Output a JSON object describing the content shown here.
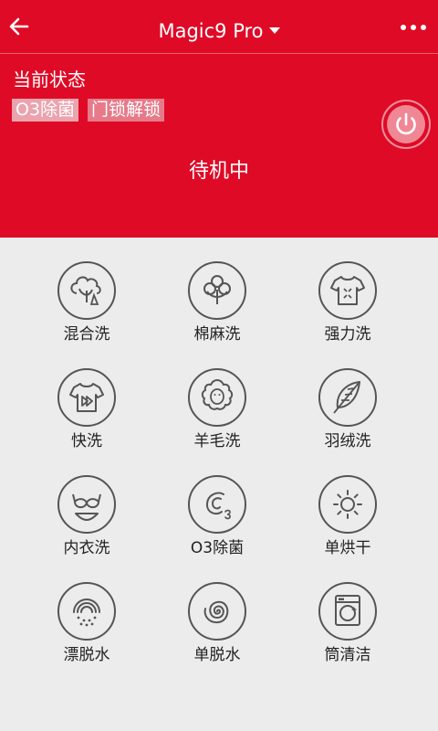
{
  "topbar": {
    "title": "Magic9 Pro",
    "back_icon": "arrow-left-icon",
    "more_icon": "more-dots-icon"
  },
  "status": {
    "label": "当前状态",
    "chips": [
      "O3除菌",
      "门锁解锁"
    ],
    "state": "待机中",
    "power_icon": "power-icon"
  },
  "colors": {
    "brand_red": "#df0a26",
    "background": "#ececec",
    "icon_stroke": "#555555"
  },
  "modes": [
    {
      "label": "混合洗",
      "icon": "mixed-wash-icon"
    },
    {
      "label": "棉麻洗",
      "icon": "cotton-icon"
    },
    {
      "label": "强力洗",
      "icon": "heavy-shirt-icon"
    },
    {
      "label": "快洗",
      "icon": "quick-wash-shirt-icon"
    },
    {
      "label": "羊毛洗",
      "icon": "wool-sheep-icon"
    },
    {
      "label": "羽绒洗",
      "icon": "down-feather-icon"
    },
    {
      "label": "内衣洗",
      "icon": "underwear-icon"
    },
    {
      "label": "O3除菌",
      "icon": "ozone-sterilize-icon"
    },
    {
      "label": "单烘干",
      "icon": "dry-sun-icon"
    },
    {
      "label": "漂脱水",
      "icon": "rinse-spin-icon"
    },
    {
      "label": "单脱水",
      "icon": "spin-spiral-icon"
    },
    {
      "label": "筒清洁",
      "icon": "drum-clean-icon"
    }
  ]
}
